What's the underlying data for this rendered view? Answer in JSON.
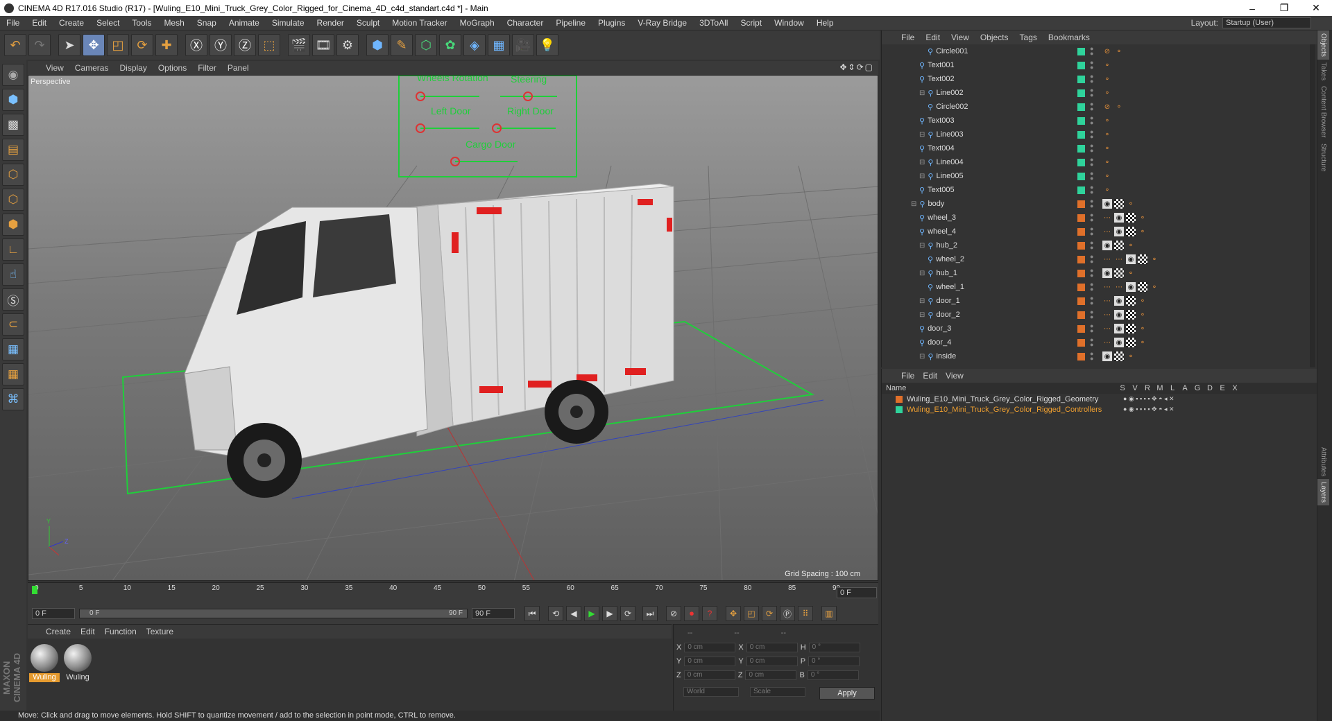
{
  "window": {
    "title": "CINEMA 4D R17.016 Studio (R17) - [Wuling_E10_Mini_Truck_Grey_Color_Rigged_for_Cinema_4D_c4d_standart.c4d *] - Main"
  },
  "menubar": {
    "items": [
      "File",
      "Edit",
      "Create",
      "Select",
      "Tools",
      "Mesh",
      "Snap",
      "Animate",
      "Simulate",
      "Render",
      "Sculpt",
      "Motion Tracker",
      "MoGraph",
      "Character",
      "Pipeline",
      "Plugins",
      "V-Ray Bridge",
      "3DToAll",
      "Script",
      "Window",
      "Help"
    ],
    "layout_label": "Layout:",
    "layout_value": "Startup (User)"
  },
  "viewport": {
    "menu": [
      "View",
      "Cameras",
      "Display",
      "Options",
      "Filter",
      "Panel"
    ],
    "label": "Perspective",
    "grid_spacing": "Grid Spacing : 100 cm",
    "controller_labels": [
      "Wheels Rotation",
      "Steering",
      "Left Door",
      "Right Door",
      "Cargo Door"
    ]
  },
  "timeline": {
    "ticks": [
      "0",
      "5",
      "10",
      "15",
      "20",
      "25",
      "30",
      "35",
      "40",
      "45",
      "50",
      "55",
      "60",
      "65",
      "70",
      "75",
      "80",
      "85",
      "90"
    ],
    "current": "0 F",
    "start": "0 F",
    "range_start": "0 F",
    "range_end": "90 F",
    "end": "90 F"
  },
  "materials": {
    "menu": [
      "Create",
      "Edit",
      "Function",
      "Texture"
    ],
    "items": [
      "Wuling",
      "Wuling"
    ]
  },
  "coords": {
    "header": [
      "--",
      "--",
      "--"
    ],
    "rows": [
      {
        "a": "X",
        "av": "0 cm",
        "b": "X",
        "bv": "0 cm",
        "c": "H",
        "cv": "0 °"
      },
      {
        "a": "Y",
        "av": "0 cm",
        "b": "Y",
        "bv": "0 cm",
        "c": "P",
        "cv": "0 °"
      },
      {
        "a": "Z",
        "av": "0 cm",
        "b": "Z",
        "bv": "0 cm",
        "c": "B",
        "cv": "0 °"
      }
    ],
    "world": "World",
    "scale": "Scale",
    "apply": "Apply"
  },
  "status": "Move: Click and drag to move elements. Hold SHIFT to quantize movement / add to the selection in point mode, CTRL to remove.",
  "objects": {
    "menu": [
      "File",
      "Edit",
      "View",
      "Objects",
      "Tags",
      "Bookmarks"
    ],
    "rows": [
      {
        "name": "Circle001",
        "indent": 3,
        "color": "#2fd39b",
        "tag": "noball"
      },
      {
        "name": "Text001",
        "indent": 2,
        "color": "#2fd39b",
        "tag": "dot"
      },
      {
        "name": "Text002",
        "indent": 2,
        "color": "#2fd39b",
        "tag": "dot"
      },
      {
        "name": "Line002",
        "indent": 2,
        "color": "#2fd39b",
        "tag": "dot",
        "exp": true
      },
      {
        "name": "Circle002",
        "indent": 3,
        "color": "#2fd39b",
        "tag": "noball"
      },
      {
        "name": "Text003",
        "indent": 2,
        "color": "#2fd39b",
        "tag": "dot"
      },
      {
        "name": "Line003",
        "indent": 2,
        "color": "#2fd39b",
        "tag": "dot",
        "exp": true
      },
      {
        "name": "Text004",
        "indent": 2,
        "color": "#2fd39b",
        "tag": "dot"
      },
      {
        "name": "Line004",
        "indent": 2,
        "color": "#2fd39b",
        "tag": "dot",
        "exp": true
      },
      {
        "name": "Line005",
        "indent": 2,
        "color": "#2fd39b",
        "tag": "dot",
        "exp": true
      },
      {
        "name": "Text005",
        "indent": 2,
        "color": "#2fd39b",
        "tag": "dot"
      },
      {
        "name": "body",
        "indent": 1,
        "color": "#e0702a",
        "tag": "mat",
        "exp": true
      },
      {
        "name": "wheel_3",
        "indent": 2,
        "color": "#e0702a",
        "tag": "mat2"
      },
      {
        "name": "wheel_4",
        "indent": 2,
        "color": "#e0702a",
        "tag": "mat2"
      },
      {
        "name": "hub_2",
        "indent": 2,
        "color": "#e0702a",
        "tag": "mat",
        "exp": true
      },
      {
        "name": "wheel_2",
        "indent": 3,
        "color": "#e0702a",
        "tag": "mat3"
      },
      {
        "name": "hub_1",
        "indent": 2,
        "color": "#e0702a",
        "tag": "mat",
        "exp": true
      },
      {
        "name": "wheel_1",
        "indent": 3,
        "color": "#e0702a",
        "tag": "mat3"
      },
      {
        "name": "door_1",
        "indent": 2,
        "color": "#e0702a",
        "tag": "mat2",
        "exp": true
      },
      {
        "name": "door_2",
        "indent": 2,
        "color": "#e0702a",
        "tag": "mat2",
        "exp": true
      },
      {
        "name": "door_3",
        "indent": 2,
        "color": "#e0702a",
        "tag": "mat2"
      },
      {
        "name": "door_4",
        "indent": 2,
        "color": "#e0702a",
        "tag": "mat2"
      },
      {
        "name": "inside",
        "indent": 2,
        "color": "#e0702a",
        "tag": "mat",
        "exp": true
      }
    ]
  },
  "layers": {
    "menu": [
      "File",
      "Edit",
      "View"
    ],
    "header": "Name",
    "cols": [
      "S",
      "V",
      "R",
      "M",
      "L",
      "A",
      "G",
      "D",
      "E",
      "X"
    ],
    "rows": [
      {
        "name": "Wuling_E10_Mini_Truck_Grey_Color_Rigged_Geometry",
        "color": "#e0702a",
        "text": "#dddddd"
      },
      {
        "name": "Wuling_E10_Mini_Truck_Grey_Color_Rigged_Controllers",
        "color": "#2fd39b",
        "text": "#f0a030"
      }
    ]
  },
  "sidetabs": [
    "Objects",
    "Takes",
    "Content Browser",
    "Structure",
    "Attributes",
    "Layers"
  ]
}
